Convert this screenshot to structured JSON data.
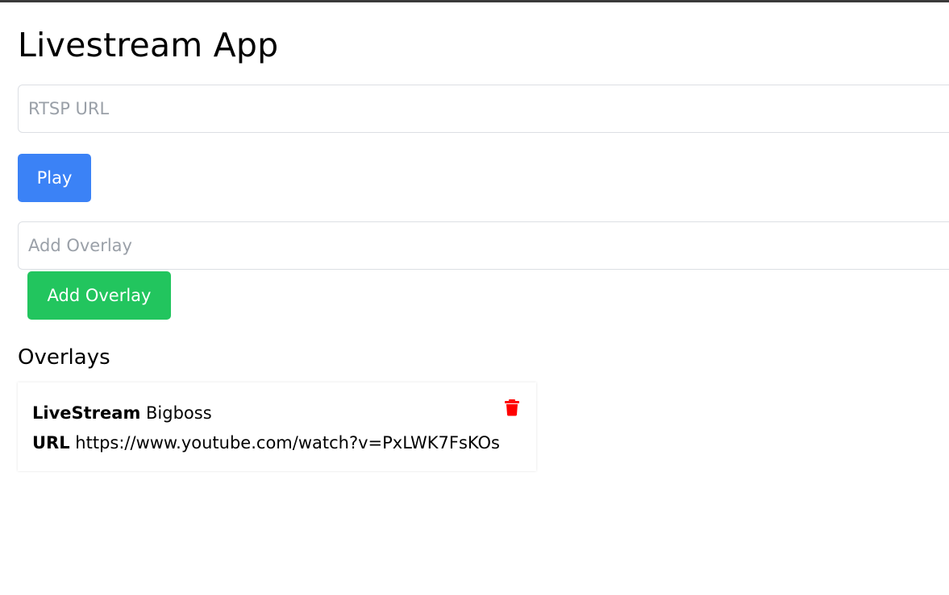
{
  "app": {
    "title": "Livestream App"
  },
  "stream": {
    "url_placeholder": "RTSP URL",
    "url_value": "",
    "play_label": "Play"
  },
  "overlay_form": {
    "placeholder": "Add Overlay",
    "value": "",
    "add_label": "Add Overlay"
  },
  "overlays": {
    "heading": "Overlays",
    "items": [
      {
        "name_label": "LiveStream",
        "name_value": "Bigboss",
        "url_label": "URL",
        "url_value": "https://www.youtube.com/watch?v=PxLWK7FsKOs",
        "delete_icon": "trash-icon"
      }
    ]
  },
  "colors": {
    "play_button": "#3b82f6",
    "add_button": "#22c55e",
    "delete_icon": "#ff0000"
  }
}
